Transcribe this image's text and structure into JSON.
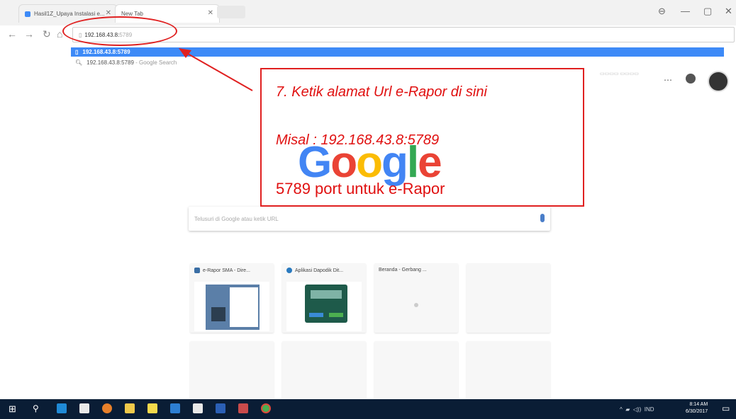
{
  "browser": {
    "tabs": [
      {
        "label": "Hasil1Z_Upaya Instalasi e..."
      },
      {
        "label": "New Tab"
      }
    ],
    "omnibox": {
      "typed": "192.168.43.8:",
      "autocomplete": "5789"
    },
    "suggestions": [
      {
        "text": "192.168.43.8:5789"
      },
      {
        "text": "192.168.43.8:5789",
        "suffix": "- Google Search"
      }
    ]
  },
  "newtab": {
    "search_placeholder": "Telusuri di Google atau ketik URL",
    "tiles": [
      {
        "title": "e-Rapor SMA - Dire...",
        "color": "#3a6ea5"
      },
      {
        "title": "Aplikasi Dapodik Dit...",
        "color": "#1e5a4a"
      },
      {
        "title": "Beranda - Gerbang ...",
        "color": "#cccccc"
      },
      {
        "title": ""
      }
    ]
  },
  "annotation": {
    "line1": "7. Ketik alamat Url e-Rapor di sini",
    "line2": "Misal : 192.168.43.8:5789",
    "line3": "5789 port untuk e-Rapor",
    "color": "#e02020"
  },
  "taskbar": {
    "tray_lang": "IND",
    "time": "8:14 AM",
    "date": "6/30/2017"
  }
}
